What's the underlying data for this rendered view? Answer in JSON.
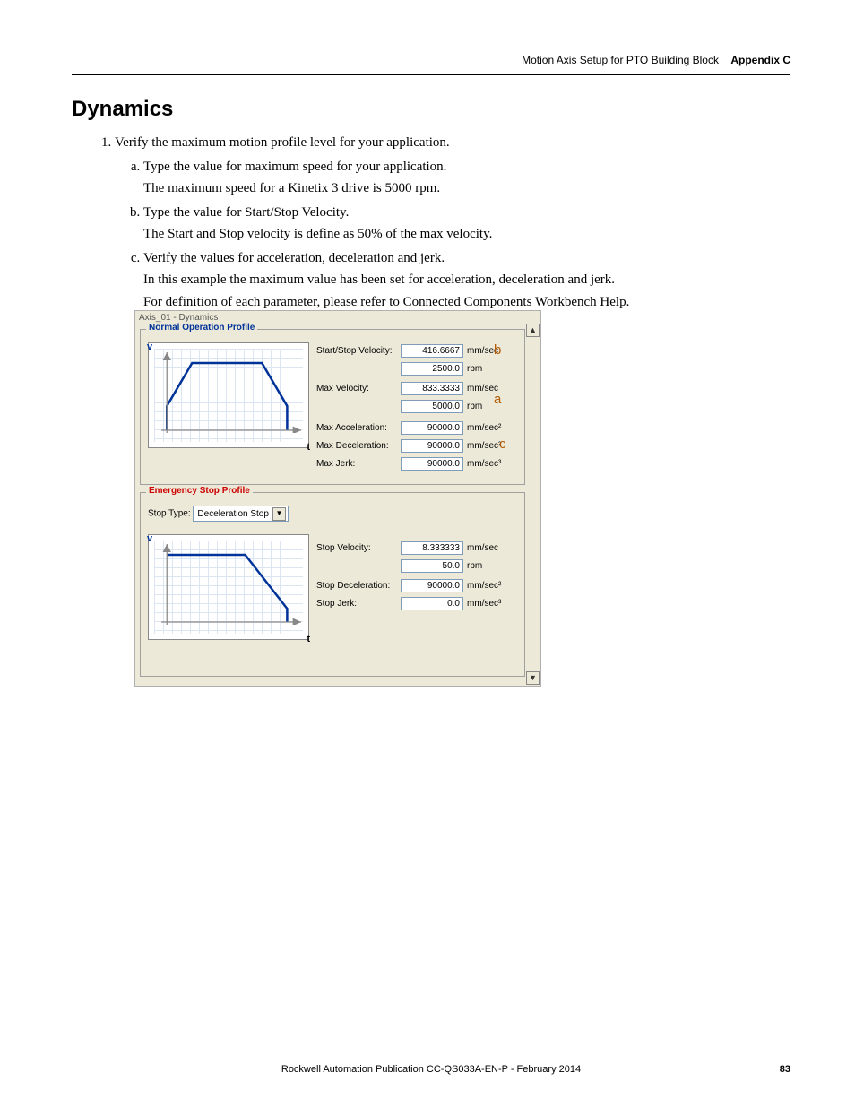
{
  "header": {
    "title": "Motion Axis Setup for PTO Building Block",
    "appendix": "Appendix C"
  },
  "section_title": "Dynamics",
  "list": {
    "step1": "Verify the maximum motion profile level for your application.",
    "a": "Type the value for maximum speed for your application.",
    "a_desc": "The maximum speed for a Kinetix 3 drive is 5000 rpm.",
    "b": "Type the value for Start/Stop Velocity.",
    "b_desc": "The Start and Stop velocity is define as 50% of the max velocity.",
    "c": "Verify the values for acceleration, deceleration and jerk.",
    "c_desc1": "In this example the maximum value has been set for acceleration, deceleration and jerk.",
    "c_desc2": "For definition of each parameter, please refer to Connected Components Workbench Help."
  },
  "panel": {
    "title": "Axis_01 - Dynamics",
    "normal_legend": "Normal Operation Profile",
    "emerg_legend": "Emergency Stop Profile",
    "stop_type_lbl": "Stop Type:",
    "stop_type_val": "Deceleration Stop",
    "axis_v": "v",
    "axis_t": "t",
    "callout_a": "a",
    "callout_b": "b",
    "callout_c": "c",
    "rows": {
      "ssv": {
        "lbl": "Start/Stop Velocity:",
        "v": "416.6667",
        "u": "mm/sec"
      },
      "ssv2": {
        "lbl": "",
        "v": "2500.0",
        "u": "rpm"
      },
      "mv": {
        "lbl": "Max Velocity:",
        "v": "833.3333",
        "u": "mm/sec"
      },
      "mv2": {
        "lbl": "",
        "v": "5000.0",
        "u": "rpm"
      },
      "ma": {
        "lbl": "Max Acceleration:",
        "v": "90000.0",
        "u": "mm/sec²"
      },
      "md": {
        "lbl": "Max Deceleration:",
        "v": "90000.0",
        "u": "mm/sec²"
      },
      "mj": {
        "lbl": "Max Jerk:",
        "v": "90000.0",
        "u": "mm/sec³"
      },
      "sv": {
        "lbl": "Stop Velocity:",
        "v": "8.333333",
        "u": "mm/sec"
      },
      "sv2": {
        "lbl": "",
        "v": "50.0",
        "u": "rpm"
      },
      "sd": {
        "lbl": "Stop Deceleration:",
        "v": "90000.0",
        "u": "mm/sec²"
      },
      "sj": {
        "lbl": "Stop Jerk:",
        "v": "0.0",
        "u": "mm/sec³"
      }
    }
  },
  "footer": {
    "pub": "Rockwell Automation Publication CC-QS033A-EN-P - February 2014",
    "page": "83"
  }
}
